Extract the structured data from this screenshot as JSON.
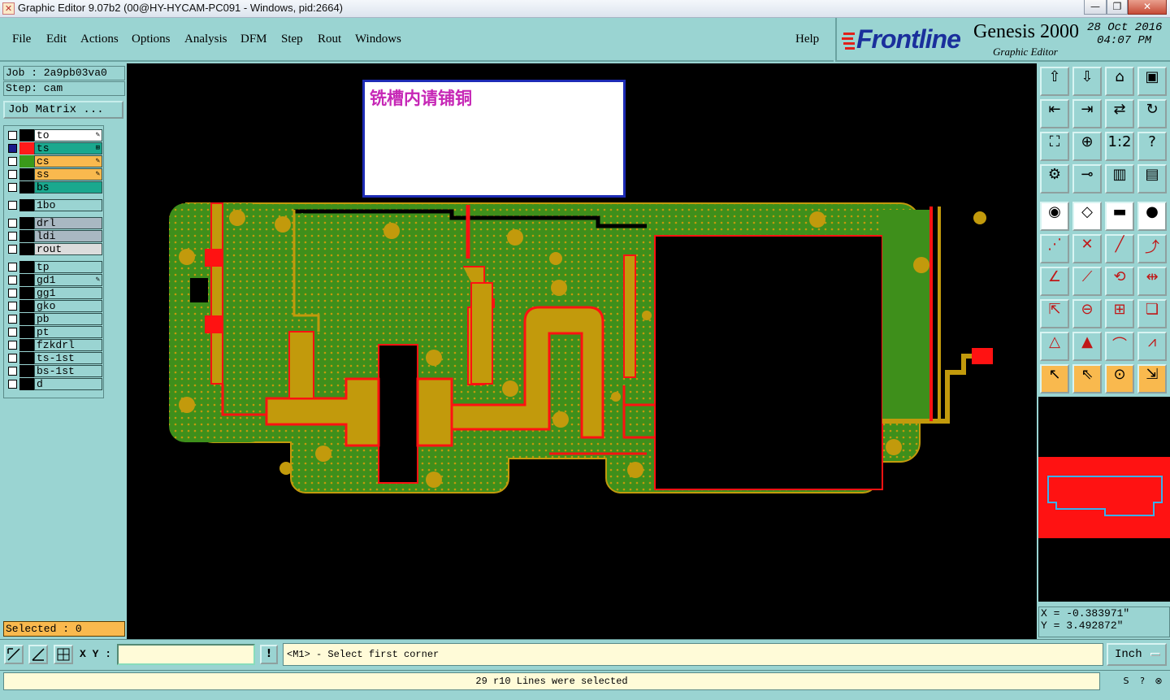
{
  "window": {
    "title": "Graphic Editor 9.07b2 (00@HY-HYCAM-PC091 - Windows, pid:2664)",
    "minimize_label": "—",
    "maximize_label": "❐",
    "close_label": "✕"
  },
  "menu": {
    "file": "File",
    "edit": "Edit",
    "actions": "Actions",
    "options": "Options",
    "analysis": "Analysis",
    "dfm": "DFM",
    "step": "Step",
    "rout": "Rout",
    "windows": "Windows",
    "help": "Help"
  },
  "brand": {
    "logo": "Frontline",
    "product": "Genesis 2000",
    "subtitle": "Graphic Editor",
    "date": "28 Oct 2016",
    "time": "04:07 PM"
  },
  "job": {
    "job_line": "Job : 2a9pb03va0",
    "step_line": "Step: cam",
    "job_matrix_button": "Job Matrix ..."
  },
  "layers": [
    {
      "name": "to",
      "color": "#000000",
      "bg": "#ffffff",
      "mark": "✎",
      "group": 0
    },
    {
      "name": "ts",
      "color": "#ff1a1a",
      "bg": "#1aa88e",
      "mark": "⊞",
      "group": 0
    },
    {
      "name": "cs",
      "color": "#3a9a1a",
      "bg": "#f9b94e",
      "mark": "✎",
      "group": 0
    },
    {
      "name": "ss",
      "color": "#000000",
      "bg": "#f9b94e",
      "mark": "✎",
      "group": 0
    },
    {
      "name": "bs",
      "color": "#000000",
      "bg": "#1aa88e",
      "mark": "",
      "group": 0
    },
    {
      "name": "1bo",
      "color": "#000000",
      "bg": "#9ad4d2",
      "mark": "",
      "group": 1
    },
    {
      "name": "drl",
      "color": "#000000",
      "bg": "#a9b8c2",
      "mark": "",
      "group": 2
    },
    {
      "name": "ldi",
      "color": "#000000",
      "bg": "#a9b8c2",
      "mark": "",
      "group": 2
    },
    {
      "name": "rout",
      "color": "#000000",
      "bg": "#dcdcdc",
      "mark": "",
      "group": 2
    },
    {
      "name": "tp",
      "color": "#000000",
      "bg": "#9ad4d2",
      "mark": "",
      "group": 3
    },
    {
      "name": "gd1",
      "color": "#000000",
      "bg": "#9ad4d2",
      "mark": "✎",
      "group": 3
    },
    {
      "name": "gg1",
      "color": "#000000",
      "bg": "#9ad4d2",
      "mark": "",
      "group": 3
    },
    {
      "name": "gko",
      "color": "#000000",
      "bg": "#9ad4d2",
      "mark": "",
      "group": 3
    },
    {
      "name": "pb",
      "color": "#000000",
      "bg": "#9ad4d2",
      "mark": "",
      "group": 3
    },
    {
      "name": "pt",
      "color": "#000000",
      "bg": "#9ad4d2",
      "mark": "",
      "group": 3
    },
    {
      "name": "fzkdrl",
      "color": "#000000",
      "bg": "#9ad4d2",
      "mark": "",
      "group": 3
    },
    {
      "name": "ts-1st",
      "color": "#000000",
      "bg": "#9ad4d2",
      "mark": "",
      "group": 3
    },
    {
      "name": "bs-1st",
      "color": "#000000",
      "bg": "#9ad4d2",
      "mark": "",
      "group": 3
    },
    {
      "name": "d",
      "color": "#000000",
      "bg": "#9ad4d2",
      "mark": "",
      "group": 3
    }
  ],
  "selected": "Selected : 0",
  "note": {
    "text": "铣槽内请铺铜"
  },
  "tools": [
    "export-icon",
    "import-icon",
    "home-icon",
    "window-icon",
    "step-in-icon",
    "step-out-icon",
    "swap-icon",
    "redraw-icon",
    "zoom-fit-icon",
    "zoom-center-icon",
    "ratio-icon",
    "help-icon",
    "measure-icon",
    "net-icon",
    "layer-compare-icon",
    "layer-stack-icon",
    "snap-icon",
    "edit-shape-icon",
    "ruler-icon",
    "pad-icon",
    "connect-icon",
    "cross-icon",
    "line-icon",
    "arc-line-icon",
    "angle-icon",
    "diagonal-icon",
    "rotate-icon",
    "mirror-icon",
    "move-layer-icon",
    "cut-line-icon",
    "grid-fit-icon",
    "copy-shape-icon",
    "triangle-icon",
    "triangle-up-icon",
    "arch-icon",
    "arch-line-icon",
    "pointer-icon",
    "select-icon",
    "select-round-icon",
    "select-multi-icon"
  ],
  "coords": {
    "x": "X = -0.383971\"",
    "y": "Y = 3.492872\""
  },
  "command": {
    "xy_label": "X Y :",
    "xy_value": "",
    "excl": "!",
    "prompt": "<M1> - Select first corner",
    "unit": "Inch"
  },
  "status": "29 r10 Lines were selected",
  "colors": {
    "panel": "#9ad4d2",
    "board_green": "#3e8f1b",
    "copper_gold": "#c29a0c",
    "trace_red": "#ff1212",
    "highlight_orange": "#f9b94e",
    "frontline_blue": "#1a2f9c",
    "note_magenta": "#c627b6"
  }
}
